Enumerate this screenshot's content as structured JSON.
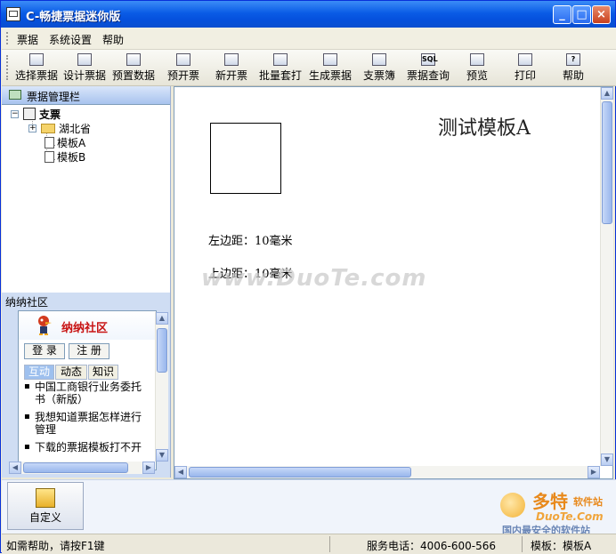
{
  "window": {
    "title": "C-畅捷票据迷你版"
  },
  "menu": [
    "票据",
    "系统设置",
    "帮助"
  ],
  "toolbar": [
    {
      "label": "选择票据",
      "icon": "open-folder-icon",
      "glyph": ""
    },
    {
      "label": "设计票据",
      "icon": "design-icon",
      "glyph": ""
    },
    {
      "label": "预置数据",
      "icon": "preset-data-icon",
      "glyph": ""
    },
    {
      "label": "预开票",
      "icon": "pre-invoice-icon",
      "glyph": ""
    },
    {
      "label": "新开票",
      "icon": "new-invoice-icon",
      "glyph": ""
    },
    {
      "label": "批量套打",
      "icon": "batch-print-icon",
      "glyph": ""
    },
    {
      "label": "生成票据",
      "icon": "generate-icon",
      "glyph": ""
    },
    {
      "label": "支票簿",
      "icon": "checkbook-icon",
      "glyph": ""
    },
    {
      "label": "票据查询",
      "icon": "sql-query-icon",
      "glyph": "SQL"
    },
    {
      "label": "预览",
      "icon": "preview-icon",
      "glyph": ""
    },
    {
      "label": "打印",
      "icon": "printer-icon",
      "glyph": ""
    },
    {
      "label": "帮助",
      "icon": "help-icon",
      "glyph": "?"
    }
  ],
  "left_panel": {
    "title": "票据管理栏",
    "tree": {
      "root": "支票",
      "folder": "湖北省",
      "items": [
        "模板A",
        "模板B"
      ]
    }
  },
  "community": {
    "header": "纳纳社区",
    "banner_title": "纳纳社区",
    "login": "登 录",
    "register": "注 册",
    "tabs": [
      "互动",
      "动态",
      "知识"
    ],
    "items": [
      "中国工商银行业务委托书（新版）",
      "我想知道票据怎样进行管理",
      "下载的票据模板打不开"
    ]
  },
  "ticket": {
    "title": "测试模板A",
    "left_margin": "左边距：10毫米",
    "top_margin": "上边距：10毫米"
  },
  "watermark": "www.DuoTe.com",
  "bottom": {
    "custom_label": "自定义",
    "logo_brand": "多特",
    "logo_suffix": "软件站",
    "logo_domain": "DuoTe.Com",
    "logo_slogan": "国内最安全的软件站"
  },
  "status": {
    "help": "如需帮助，请按F1键",
    "phone": "服务电话：4006-600-566",
    "template": "模板：模板A"
  }
}
